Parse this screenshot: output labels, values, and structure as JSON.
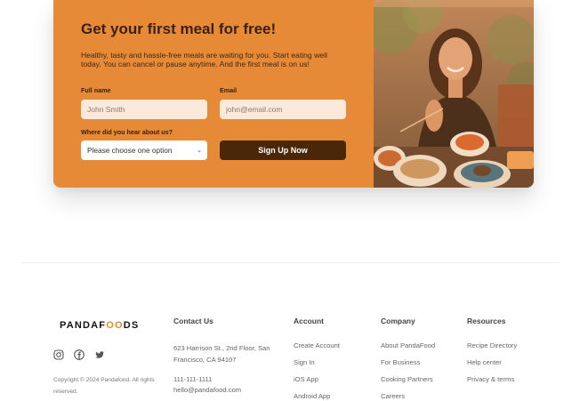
{
  "signup": {
    "title": "Get your first meal for free!",
    "description": "Healthy, tasty and hassle-free meals are waiting for you. Start eating well today. You can cancel or pause anytime. And the first meal is on us!",
    "full_name_label": "Full name",
    "full_name_placeholder": "John Smith",
    "email_label": "Email",
    "email_placeholder": "john@email.com",
    "source_label": "Where did you hear about us?",
    "source_selected": "Please choose one option",
    "submit_label": "Sign Up Now"
  },
  "footer": {
    "logo_prefix": "PANDAF",
    "logo_accent": "OO",
    "logo_suffix": "DS",
    "copyright": "Copyright © 2024 Pandafood. All rights reserved.",
    "social_icons": [
      "instagram-icon",
      "facebook-icon",
      "twitter-icon"
    ],
    "contact": {
      "heading": "Contact Us",
      "address": "623 Harrison St., 2nd Floor, San Francisco, CA 94107",
      "phone": "111-111-1111",
      "email": "hello@pandafood.com"
    },
    "account": {
      "heading": "Account",
      "links": [
        "Create Account",
        "Sign In",
        "iOS App",
        "Android App"
      ]
    },
    "company": {
      "heading": "Company",
      "links": [
        "About PandaFood",
        "For Business",
        "Cooking Partners",
        "Careers"
      ]
    },
    "resources": {
      "heading": "Resources",
      "links": [
        "Recipe Directory",
        "Help center",
        "Privacy & terms"
      ]
    }
  },
  "colors": {
    "cta_background": "#e78a38",
    "button_dark": "#4a2708",
    "logo_accent": "#e58a2f"
  }
}
